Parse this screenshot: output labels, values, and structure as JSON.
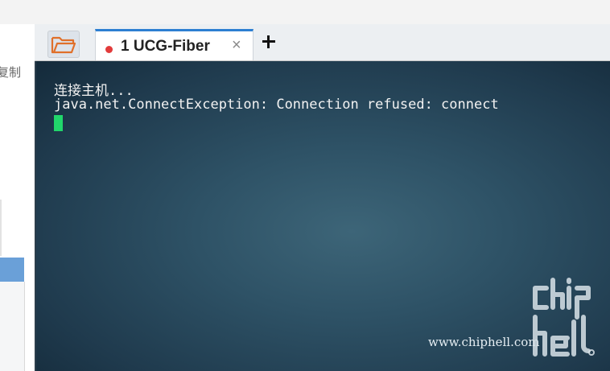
{
  "left_pane": {
    "partial_label": "复制"
  },
  "tab_bar": {
    "folder_icon": "folder-open-icon",
    "tabs": [
      {
        "label": "1 UCG-Fiber",
        "status_color": "#e23b3b",
        "close": "×",
        "active": true
      }
    ],
    "new_tab_icon": "plus-icon",
    "accent_color": "#2d7fd2"
  },
  "terminal": {
    "lines": [
      "连接主机...",
      "java.net.ConnectException: Connection refused: connect"
    ],
    "cursor_color": "#21d66b"
  },
  "watermark": {
    "url": "www.chiphell.com",
    "logo_line1": "chip",
    "logo_line2": "hell"
  }
}
